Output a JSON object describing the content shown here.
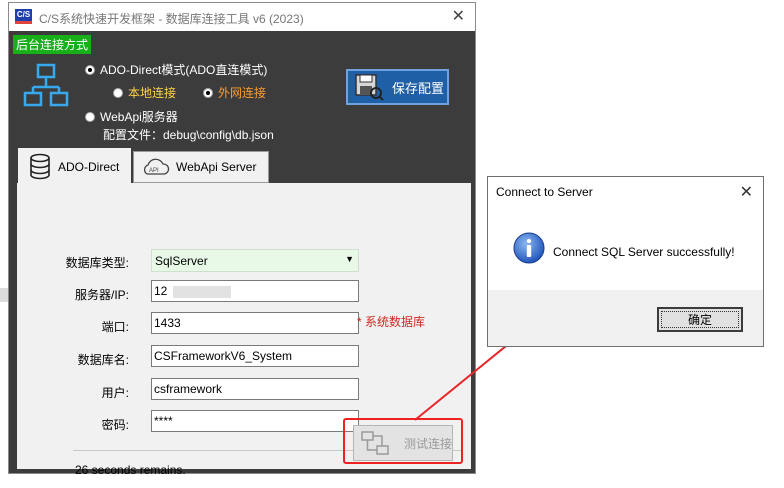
{
  "main_window": {
    "app_icon_text": "C/S",
    "title": "C/S系统快速开发框架 - 数据库连接工具 v6 (2023)"
  },
  "top_panel": {
    "mode_label": "后台连接方式",
    "ado_direct_option": "ADO-Direct模式(ADO直连模式)",
    "local_option": "本地连接",
    "external_option": "外网连接",
    "webapi_option": "WebApi服务器",
    "config_path": "配置文件：debug\\config\\db.json",
    "save_button": "保存配置",
    "colors": {
      "local_option": "#ffd24a",
      "external_option": "#ff9a2a"
    }
  },
  "tabs": [
    {
      "label": "ADO-Direct",
      "icon": "database-icon"
    },
    {
      "label": "WebApi Server",
      "icon": "cloud-api-icon"
    }
  ],
  "form": {
    "db_type_label": "数据库类型:",
    "db_type_value": "SqlServer",
    "server_label": "服务器/IP:",
    "server_value": "12",
    "port_label": "端口:",
    "port_value": "1433",
    "db_name_label": "数据库名:",
    "db_name_value": "CSFrameworkV6_System",
    "system_db_note": "* 系统数据库",
    "user_label": "用户:",
    "user_value": "csframework",
    "password_label": "密码:",
    "password_value": "****"
  },
  "status": {
    "remaining": "26 seconds remains.",
    "test_button": "测试连接"
  },
  "dialog": {
    "title": "Connect to Server",
    "message": "Connect SQL Server successfully!",
    "ok_button": "确定",
    "icon": "info-icon"
  }
}
